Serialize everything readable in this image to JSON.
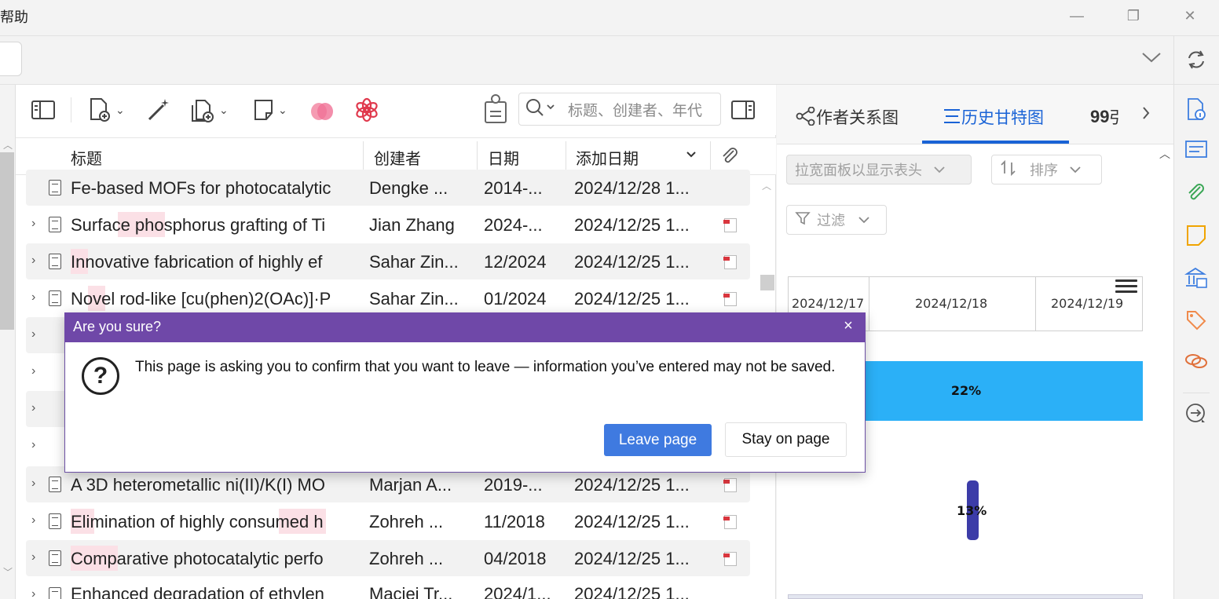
{
  "window": {
    "menu_fragment": "帮助",
    "minimize": "—",
    "maximize": "❐",
    "close": "✕"
  },
  "items_toolbar": {
    "search_placeholder": "标题、创建者、年代"
  },
  "columns": {
    "title": "标题",
    "creator": "创建者",
    "date": "日期",
    "date_added": "添加日期"
  },
  "rows": [
    {
      "title": "Fe-based MOFs for photocatalytic",
      "creator": "Dengke ...",
      "date": "2014-...",
      "added": "2024/12/28 1...",
      "has_pdf": false
    },
    {
      "title": "Surface phosphorus grafting of Ti",
      "creator": "Jian Zhang",
      "date": "2024-...",
      "added": "2024/12/25 1...",
      "has_pdf": true
    },
    {
      "title": "Innovative fabrication of highly ef",
      "creator": "Sahar Zin...",
      "date": "12/2024",
      "added": "2024/12/25 1...",
      "has_pdf": true
    },
    {
      "title": "Novel rod-like [cu(phen)2(OAc)]·P",
      "creator": "Sahar Zin...",
      "date": "01/2024",
      "added": "2024/12/25 1...",
      "has_pdf": true
    },
    {
      "title": "A 3D heterometallic ni(II)/K(I) MO",
      "creator": "Marjan A...",
      "date": "2019-...",
      "added": "2024/12/25 1...",
      "has_pdf": true
    },
    {
      "title": "Elimination of highly consumed h",
      "creator": "Zohreh ...",
      "date": "11/2018",
      "added": "2024/12/25 1...",
      "has_pdf": true
    },
    {
      "title": "Comparative photocatalytic perfo",
      "creator": "Zohreh ...",
      "date": "04/2018",
      "added": "2024/12/25 1...",
      "has_pdf": true
    },
    {
      "title": "Enhanced degradation of ethylen",
      "creator": "Maciej Tr...",
      "date": "2024/1...",
      "added": "2024/12/25 1...",
      "has_pdf": true
    }
  ],
  "right_panel": {
    "tabs": [
      "作者关系图",
      "历史甘特图",
      "引"
    ],
    "header_dropdown": "拉宽面板以显示表头",
    "sort_label": "排序",
    "filter_label": "过滤",
    "gantt_dates": [
      "2024/12/17",
      "2024/12/18",
      "2024/12/19"
    ],
    "bars": [
      {
        "label": "22%",
        "color": "#2bb0f7",
        "progress": 0.22
      },
      {
        "label": "13%",
        "color": "#3c3ca8",
        "progress": 0.13
      }
    ]
  },
  "dialog": {
    "title": "Are you sure?",
    "close": "×",
    "message": "This page is asking you to confirm that you want to leave — information you’ve entered may not be saved.",
    "leave_button": "Leave page",
    "stay_button": "Stay on page"
  },
  "colors": {
    "dialog_header": "#6f48a8",
    "primary_button": "#3f7ae0",
    "active_tab": "#1a63d6",
    "row_highlight": "#fbe0e6"
  }
}
